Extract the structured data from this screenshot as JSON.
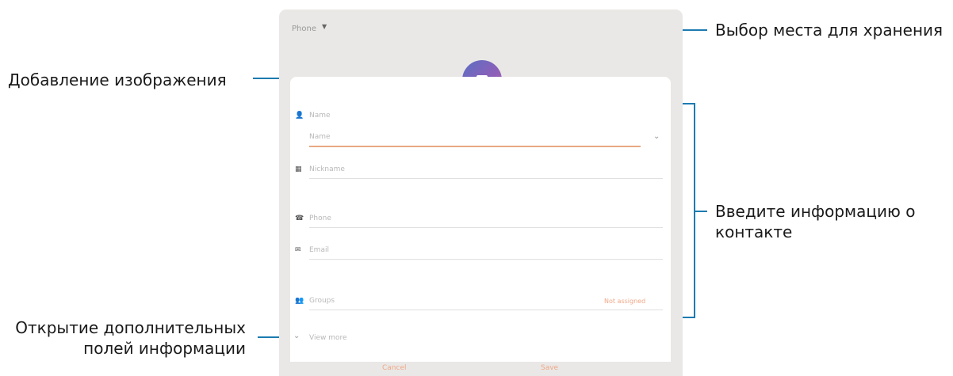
{
  "callouts": {
    "storage": "Выбор места для хранения",
    "add_image": "Добавление изображения",
    "enter_info_line1": "Введите информацию о",
    "enter_info_line2": "контакте",
    "more_fields_line1": "Открытие дополнительных",
    "more_fields_line2": "полей информации"
  },
  "phone": {
    "storage": {
      "label": "Phone",
      "icon": "chevron-down-icon"
    },
    "photo": {
      "icon": "camera-icon"
    },
    "fields": [
      {
        "icon": "person-icon",
        "label": "Name"
      },
      {
        "icon": "",
        "label": "Name"
      },
      {
        "icon": "company-icon",
        "label": "Nickname"
      },
      {
        "icon": "phone-icon",
        "label": "Phone"
      },
      {
        "icon": "email-icon",
        "label": "Email"
      },
      {
        "icon": "group-icon",
        "label": "Groups"
      }
    ],
    "groups_action": "Not assigned",
    "view_more": {
      "label": "View more",
      "icon": "chevron-down-icon"
    },
    "buttons": {
      "cancel": "Cancel",
      "save": "Save"
    }
  },
  "colors": {
    "accent_line": "#1c7bb0",
    "active_underline": "#e9a882",
    "action_text": "#f0a888"
  }
}
